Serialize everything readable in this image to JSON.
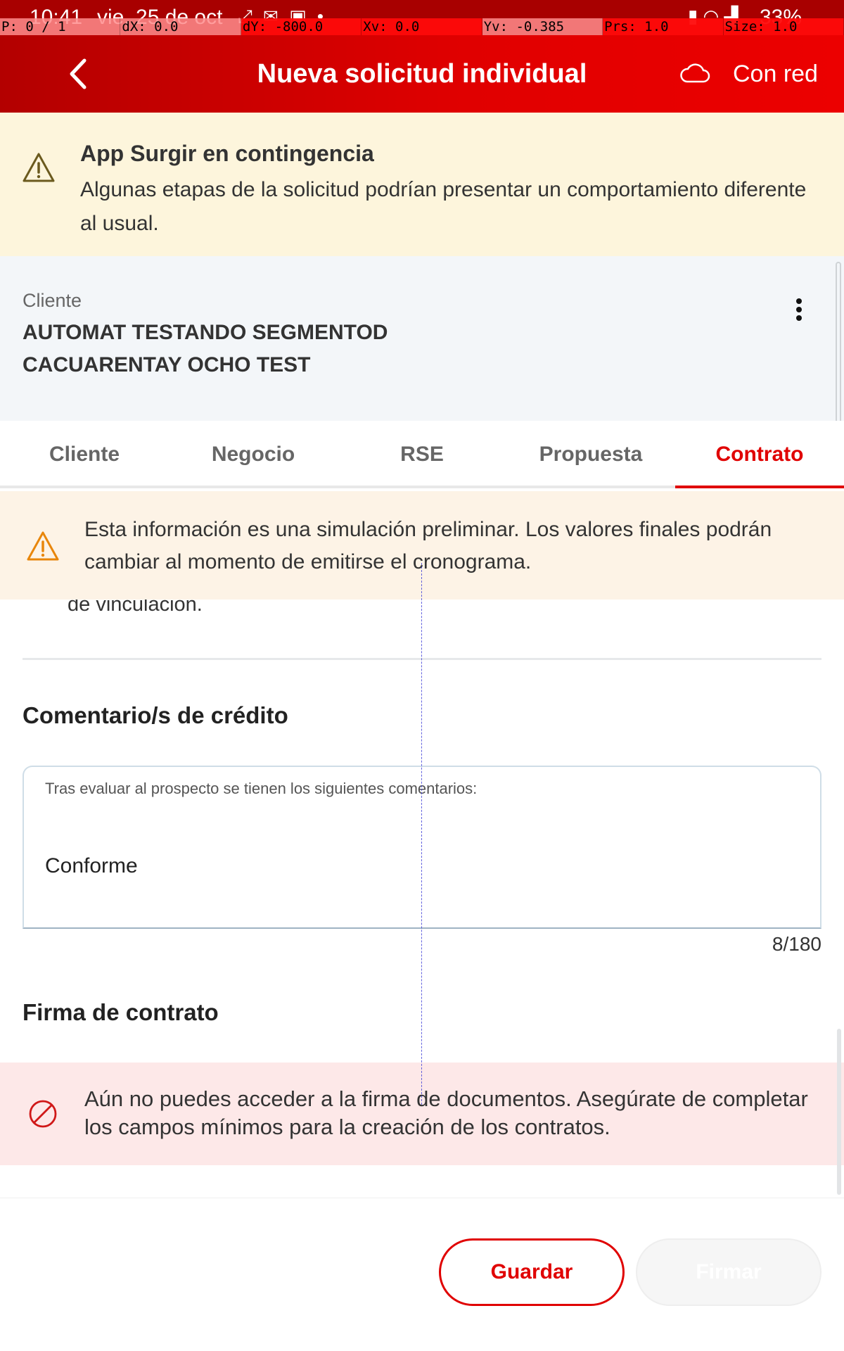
{
  "status_bar": {
    "time": "10:41",
    "date": "vie, 25 de oct",
    "battery": "33%",
    "notification_icons": [
      "arrows-icon",
      "gmail-icon",
      "calendar-icon",
      "dot-icon"
    ],
    "system_icons": [
      "battery-saver-icon",
      "wifi-icon",
      "signal-icon"
    ]
  },
  "debug_overlay": [
    {
      "label": "P: 0 / 1"
    },
    {
      "label": "dX: 0.0"
    },
    {
      "label": "dY: -800.0"
    },
    {
      "label": "Xv: 0.0"
    },
    {
      "label": "Yv: -0.385"
    },
    {
      "label": "Prs: 1.0"
    },
    {
      "label": "Size: 1.0"
    }
  ],
  "app_bar": {
    "title": "Nueva solicitud individual",
    "network_status": "Con red"
  },
  "contingency_banner": {
    "title": "App Surgir en contingencia",
    "body": "Algunas etapas de la solicitud podrían presentar un comportamiento diferente al usual."
  },
  "client": {
    "label": "Cliente",
    "name": "AUTOMAT TESTANDO SEGMENTOD CACUARENTAY OCHO TEST"
  },
  "tabs": [
    {
      "label": "Cliente",
      "active": false
    },
    {
      "label": "Negocio",
      "active": false
    },
    {
      "label": "RSE",
      "active": false
    },
    {
      "label": "Propuesta",
      "active": false
    },
    {
      "label": "Contrato",
      "active": true
    }
  ],
  "simulation_notice": "Esta información es una simulación preliminar. Los valores finales podrán cambiar al momento de emitirse el cronograma.",
  "partial_text": "de vinculación.",
  "credit_comments": {
    "title": "Comentario/s de crédito",
    "caption": "Tras evaluar al prospecto se tienen los siguientes comentarios:",
    "value": "Conforme",
    "counter": "8/180"
  },
  "contract_signature": {
    "title": "Firma de contrato",
    "message": "Aún no puedes acceder a la firma de documentos. Asegúrate de completar los campos mínimos para la creación de los contratos."
  },
  "actions": {
    "save_label": "Guardar",
    "sign_label": "Firmar"
  },
  "colors": {
    "brand_red": "#e00000",
    "warning_bg": "#fdf5dc",
    "notice_bg": "#fdf3e6",
    "error_bg": "#fde8e8"
  }
}
